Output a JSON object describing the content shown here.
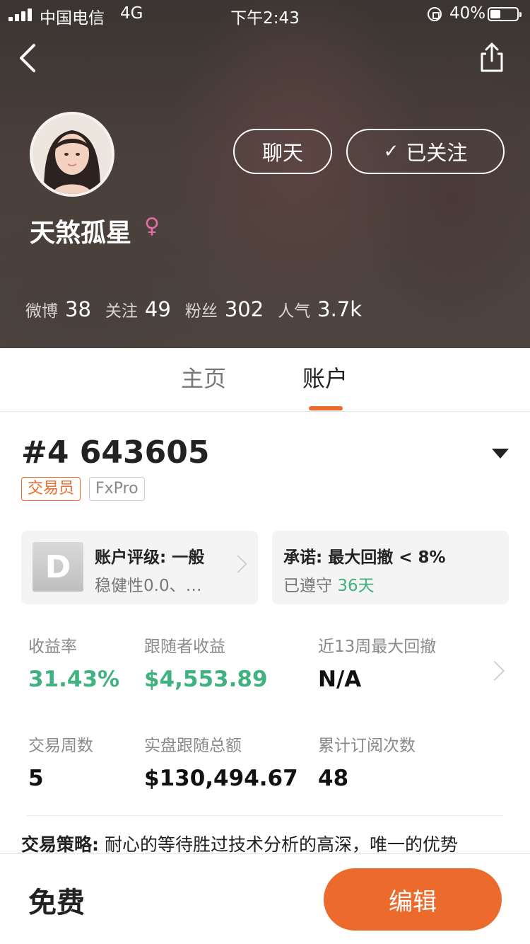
{
  "status_bar": {
    "carrier": "中国电信",
    "network": "4G",
    "time": "下午2:43",
    "battery": "40%"
  },
  "profile": {
    "username": "天煞孤星",
    "gender_symbol": "♀",
    "chat_label": "聊天",
    "follow_label": "已关注",
    "stats": [
      {
        "label": "微博",
        "value": "38"
      },
      {
        "label": "关注",
        "value": "49"
      },
      {
        "label": "粉丝",
        "value": "302"
      },
      {
        "label": "人气",
        "value": "3.7k"
      }
    ]
  },
  "tabs": [
    "主页",
    "账户"
  ],
  "account": {
    "title": "#4 643605",
    "tag_role": "交易员",
    "tag_broker": "FxPro",
    "rating": {
      "grade": "D",
      "title": "账户评级: 一般",
      "subtitle": "稳健性0.0、…"
    },
    "promise": {
      "title": "承诺: 最大回撤 < 8%",
      "kept_prefix": "已遵守",
      "days": "36天"
    },
    "metrics": [
      {
        "label": "收益率",
        "value": "31.43%"
      },
      {
        "label": "跟随者收益",
        "value": "$4,553.89"
      },
      {
        "label": "近13周最大回撤",
        "value": "N/A"
      },
      {
        "label": "交易周数",
        "value": "5"
      },
      {
        "label": "实盘跟随总额",
        "value": "$130,494.67"
      },
      {
        "label": "累计订阅次数",
        "value": "48"
      }
    ],
    "strategy_label": "交易策略:",
    "strategy_text": "耐心的等待胜过技术分析的高深，唯一的优势"
  },
  "bottom": {
    "price": "免费",
    "edit_label": "编辑"
  },
  "colors": {
    "accent": "#ec6a2c",
    "positive": "#3fb27f"
  }
}
